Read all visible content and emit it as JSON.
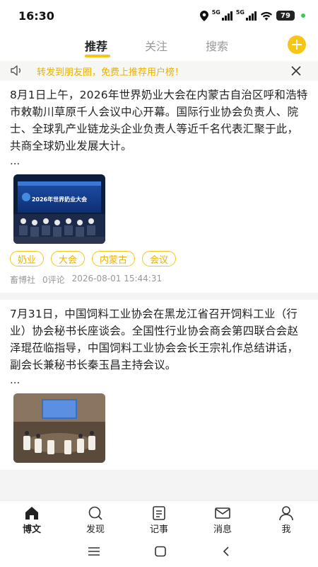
{
  "status": {
    "time": "16:30",
    "net1": "5G",
    "net2": "5G",
    "battery": "79"
  },
  "tabs": [
    {
      "label": "推荐",
      "active": true
    },
    {
      "label": "关注",
      "active": false
    },
    {
      "label": "搜索",
      "active": false
    }
  ],
  "notice": {
    "text": "转发到朋友圈，免费上推荐用户榜！"
  },
  "posts": [
    {
      "text": "8月1日上午，2026年世界奶业大会在内蒙古自治区呼和浩特市敕勒川草原千人会议中心开幕。国际行业协会负责人、院士、全球乳产业链龙头企业负责人等近千名代表汇聚于此，共商全球奶业发展大计。",
      "ellipsis": "...",
      "image_caption": "2026年世界奶业大会",
      "tags": [
        "奶业",
        "大会",
        "内蒙古",
        "会议"
      ],
      "author": "畜博社",
      "comments": "0评论",
      "time": "2026-08-01 15:44:31"
    },
    {
      "text": "7月31日，中国饲料工业协会在黑龙江省召开饲料工业（行业）协会秘书长座谈会。全国性行业协会商会第四联合会赵泽琨莅临指导，中国饲料工业协会会长王宗礼作总结讲话，副会长兼秘书长秦玉昌主持会议。",
      "ellipsis": "..."
    }
  ],
  "bottom_nav": [
    {
      "label": "博文",
      "icon": "home-icon",
      "active": true
    },
    {
      "label": "发现",
      "icon": "search-icon",
      "active": false
    },
    {
      "label": "记事",
      "icon": "notes-icon",
      "active": false
    },
    {
      "label": "消息",
      "icon": "mail-icon",
      "active": false
    },
    {
      "label": "我",
      "icon": "user-icon",
      "active": false
    }
  ],
  "colors": {
    "accent": "#f5c518",
    "accent_text": "#e8b200"
  }
}
